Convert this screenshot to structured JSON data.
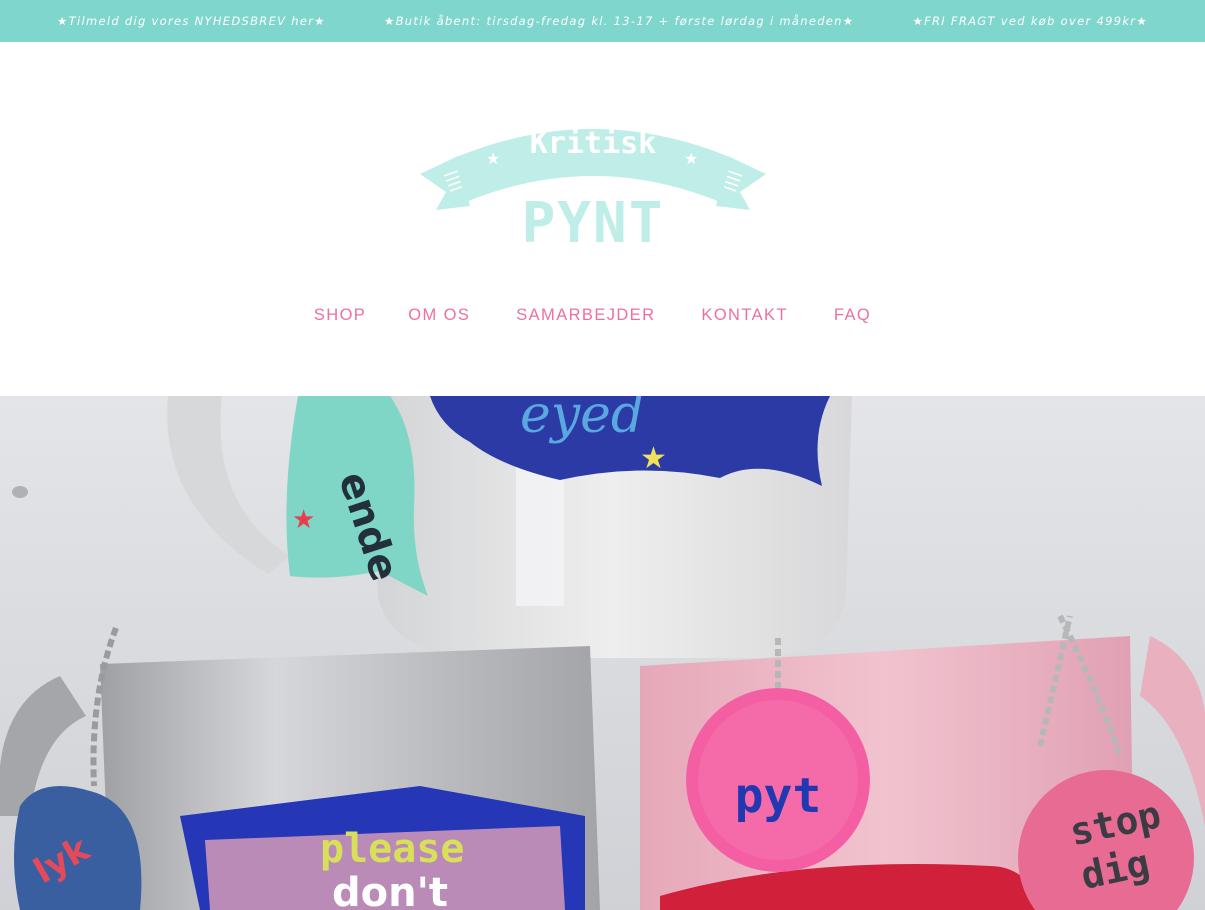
{
  "announcement_bar": {
    "items": [
      "★Tilmeld dig vores NYHEDSBREV her★",
      "★Butik åbent: tirsdag-fredag kl. 13-17 + første lørdag i måneden★",
      "★FRI FRAGT ved køb over 499kr★"
    ],
    "background": "#7fd6cc",
    "text_color": "#ffffff"
  },
  "logo": {
    "line1": "Kritisk",
    "line2": "PYNT",
    "color": "#bfeee8",
    "icon": "ribbon-banner-logo"
  },
  "nav": {
    "items": [
      "SHOP",
      "OM OS",
      "SAMARBEJDER",
      "KONTAKT",
      "FAQ"
    ],
    "color": "#ee6fa1"
  },
  "hero": {
    "alt": "hero-photo-mugs",
    "mug_texts": {
      "top_mug_tag": "ende",
      "left_mug": [
        "please",
        "don't"
      ],
      "right_tag_1": "pyt",
      "right_tag_2": [
        "stop",
        "dig"
      ]
    }
  }
}
